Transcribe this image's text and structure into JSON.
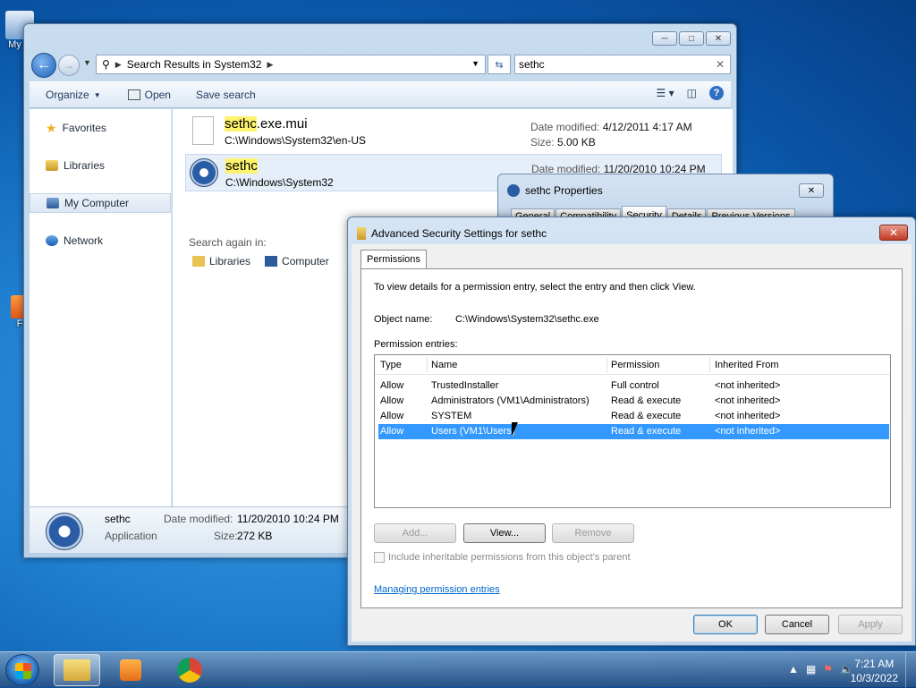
{
  "desktop": {
    "icon1_label": "My C",
    "icon2_label": "F"
  },
  "explorer": {
    "address": {
      "path": "Search Results in System32"
    },
    "search": {
      "value": "sethc"
    },
    "toolbar": {
      "organize": "Organize",
      "open": "Open",
      "save_search": "Save search"
    },
    "nav": {
      "favorites": "Favorites",
      "libraries": "Libraries",
      "my_computer": "My Computer",
      "network": "Network"
    },
    "results": [
      {
        "name_hl": "sethc",
        "name_rest": ".exe.mui",
        "path": "C:\\Windows\\System32\\en-US",
        "modified_label": "Date modified:",
        "modified": "4/12/2011 4:17 AM",
        "size_label": "Size:",
        "size": "5.00 KB"
      },
      {
        "name_hl": "sethc",
        "name_rest": "",
        "path": "C:\\Windows\\System32",
        "modified_label": "Date modified:",
        "modified": "11/20/2010 10:24 PM"
      }
    ],
    "search_again": {
      "label": "Search again in:",
      "libraries": "Libraries",
      "computer": "Computer"
    },
    "details": {
      "name": "sethc",
      "type": "Application",
      "modified_label": "Date modified:",
      "modified": "11/20/2010 10:24 PM",
      "size_label": "Size:",
      "size": "272 KB"
    }
  },
  "properties": {
    "title": "sethc Properties",
    "tabs": [
      "General",
      "Compatibility",
      "Security",
      "Details",
      "Previous Versions"
    ]
  },
  "advanced": {
    "title": "Advanced Security Settings for sethc",
    "tab": "Permissions",
    "instructions": "To view details for a permission entry, select the entry and then click View.",
    "object_label": "Object name:",
    "object_value": "C:\\Windows\\System32\\sethc.exe",
    "entries_label": "Permission entries:",
    "columns": [
      "Type",
      "Name",
      "Permission",
      "Inherited From"
    ],
    "rows": [
      {
        "type": "Allow",
        "name": "TrustedInstaller",
        "permission": "Full control",
        "inherited": "<not inherited>"
      },
      {
        "type": "Allow",
        "name": "Administrators (VM1\\Administrators)",
        "permission": "Read & execute",
        "inherited": "<not inherited>"
      },
      {
        "type": "Allow",
        "name": "SYSTEM",
        "permission": "Read & execute",
        "inherited": "<not inherited>"
      },
      {
        "type": "Allow",
        "name": "Users (VM1\\Users)",
        "permission": "Read & execute",
        "inherited": "<not inherited>"
      }
    ],
    "buttons": {
      "add": "Add...",
      "view": "View...",
      "remove": "Remove",
      "ok": "OK",
      "cancel": "Cancel",
      "apply": "Apply"
    },
    "include_inheritable": "Include inheritable permissions from this object's parent",
    "manage_link": "Managing permission entries"
  },
  "taskbar": {
    "time": "7:21 AM",
    "date": "10/3/2022"
  },
  "colors": {
    "selection": "#3399ff",
    "highlight": "#fef36d",
    "link": "#0066cc"
  }
}
